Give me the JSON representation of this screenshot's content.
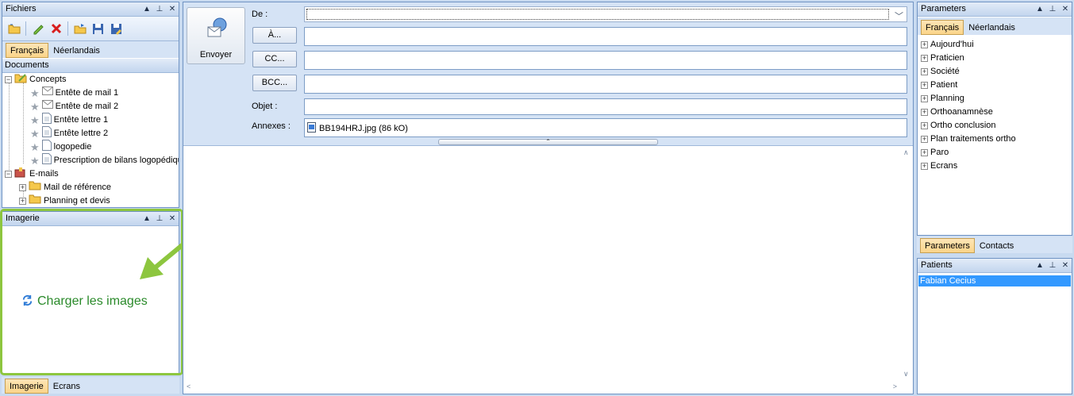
{
  "fichiers": {
    "title": "Fichiers",
    "header_buttons": [
      "▲",
      "⊥",
      "✕"
    ],
    "toolbar_icons": [
      "folder-open-icon",
      "edit-icon",
      "delete-icon",
      "open-icon",
      "save-icon",
      "save-as-icon"
    ],
    "tabs": [
      "Français",
      "Néerlandais"
    ],
    "documents_label": "Documents",
    "tree": {
      "concepts": "Concepts",
      "items": [
        "Entête de mail 1",
        "Entête de mail 2",
        "Entête lettre 1",
        "Entête lettre 2",
        "logopedie",
        "Prescription de bilans logopédique"
      ],
      "emails": "E-mails",
      "email_folders": [
        "Mail de référence",
        "Planning et devis"
      ]
    }
  },
  "imagerie": {
    "title": "Imagerie",
    "load_label": "Charger les images",
    "tabs": [
      "Imagerie",
      "Ecrans"
    ]
  },
  "email": {
    "send_label": "Envoyer",
    "from_label": "De :",
    "to_button": "À...",
    "cc_button": "CC...",
    "bcc_button": "BCC...",
    "subject_label": "Objet :",
    "attachments_label": "Annexes :",
    "attachment": "BB194HRJ.jpg (86 kO)",
    "from_value": "",
    "to_value": "",
    "cc_value": "",
    "bcc_value": "",
    "subject_value": ""
  },
  "parameters": {
    "title": "Parameters",
    "tabs": [
      "Français",
      "Néerlandais"
    ],
    "items": [
      "Aujourd'hui",
      "Praticien",
      "Société",
      "Patient",
      "Planning",
      "Orthoanamnèse",
      "Ortho conclusion",
      "Plan traitements ortho",
      "Paro",
      "Ecrans"
    ],
    "bottom_tabs": [
      "Parameters",
      "Contacts"
    ]
  },
  "patients": {
    "title": "Patients",
    "selected": "Fabian Cecius"
  },
  "colors": {
    "accent_green": "#8dc63f",
    "selection_blue": "#3399ff",
    "link_green": "#2a8a2a"
  }
}
